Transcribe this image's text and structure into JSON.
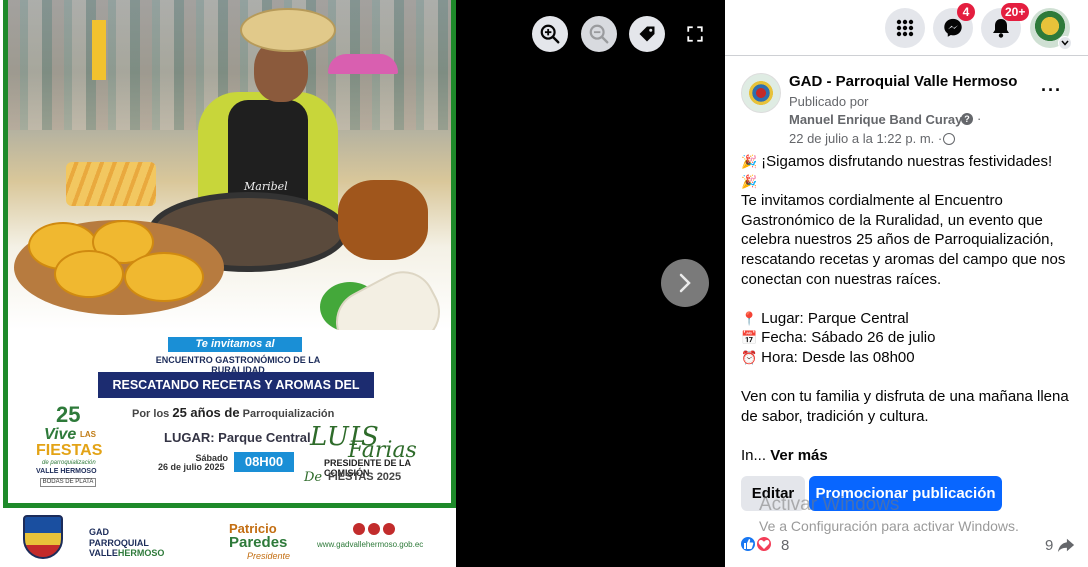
{
  "viewer": {
    "controls": {
      "zoom_in": "zoom-in-icon",
      "zoom_out": "zoom-out-icon",
      "tag": "tag-icon",
      "fullscreen": "fullscreen-icon",
      "next": "chevron-right-icon"
    },
    "poster": {
      "brand_mark": "Maribel",
      "invite": "Te invitamos al",
      "encuentro": "ENCUENTRO GASTRONÓMICO DE LA RURALIDAD",
      "rescate": "RESCATANDO RECETAS Y AROMAS DEL CAMPO",
      "anos_prefix": "Por los ",
      "anos_num": "25",
      "anos_mid": " años de",
      "anos_suffix": " Parroquialización",
      "lugar": "LUGAR: Parque Central",
      "sabado": "Sábado",
      "fecha": "26 de julio 2025",
      "hora": "08H00",
      "luis": "LUIS",
      "farias": "Farias",
      "presidente": "PRESIDENTE DE LA COMISIÓN",
      "de": "De",
      "fiestas": "FIESTAS 2025",
      "logo": {
        "n25": "25",
        "vive": "Vive",
        "las": "LAS",
        "fiestas": "FIESTAS",
        "parr": "de parroquialización",
        "vh": "VALLE HERMOSO",
        "bodas": "BODAS DE PLATA"
      },
      "footer": {
        "gad": "GAD",
        "parroquial": "PARROQUIAL",
        "valle": "VALLE",
        "hermoso": "HERMOSO",
        "patricio": "Patricio",
        "paredes": "Paredes",
        "presidente": "Presidente",
        "web": "www.gadvallehermoso.gob.ec"
      }
    }
  },
  "topbar": {
    "menu_icon": "grid-menu-icon",
    "messenger_badge": "4",
    "notifications_badge": "20+"
  },
  "post": {
    "page_name": "GAD - Parroquial Valle Hermoso",
    "published_by": "Publicado por",
    "author": "Manuel Enrique Band Curay",
    "help": "?",
    "sep": "·",
    "date": "22 de julio a la 1:22 p. m. ·",
    "more": "···",
    "lines": {
      "l1": "¡Sigamos disfrutando nuestras festividades!",
      "l2": "Te invitamos cordialmente al Encuentro Gastronómico de la Ruralidad, un evento que celebra nuestros 25 años de Parroquialización, rescatando recetas y aromas del campo que nos conectan con nuestras raíces.",
      "lugar": "Lugar: Parque Central",
      "fecha": "Fecha: Sábado 26 de julio",
      "hora": "Hora: Desde las 08h00",
      "cierre": "Ven con tu familia y disfruta de una mañana llena de sabor, tradición y cultura.",
      "in": "In...",
      "see_more": "Ver más"
    },
    "emoji": {
      "party": "🎉",
      "pin": "📍",
      "calendar": "📅",
      "clock": "⏰"
    },
    "edit_label": "Editar",
    "promote_label": "Promocionar publicación",
    "watermark_title": "Activar Windows",
    "watermark_sub": "Ve a Configuración para activar Windows.",
    "reactions_count": "8",
    "shares_count": "9"
  },
  "colors": {
    "primary": "#0866ff",
    "badge": "#e41e3f",
    "poster_green": "#1e8a2a",
    "poster_navy": "#1c2c70"
  }
}
